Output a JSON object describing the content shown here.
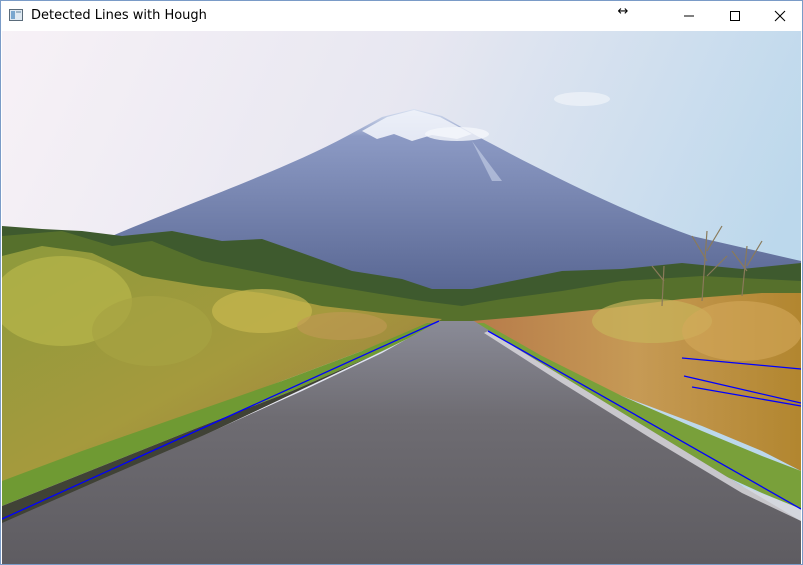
{
  "window": {
    "title": "Detected Lines with Hough"
  },
  "controls": {
    "resize_icon": "resize-arrows-icon",
    "minimize_icon": "minimize-icon",
    "maximize_icon": "maximize-icon",
    "close_icon": "close-icon"
  },
  "image": {
    "watermark": "...",
    "description_colors": {
      "sky_top": "#f3eef5",
      "sky_right": "#bcd8ec",
      "mountain": "#5f6e9c",
      "forest": "#3f5a2a",
      "field": "#b7a144",
      "road": "#6c6a6e",
      "line_color": "#0000ff"
    }
  }
}
